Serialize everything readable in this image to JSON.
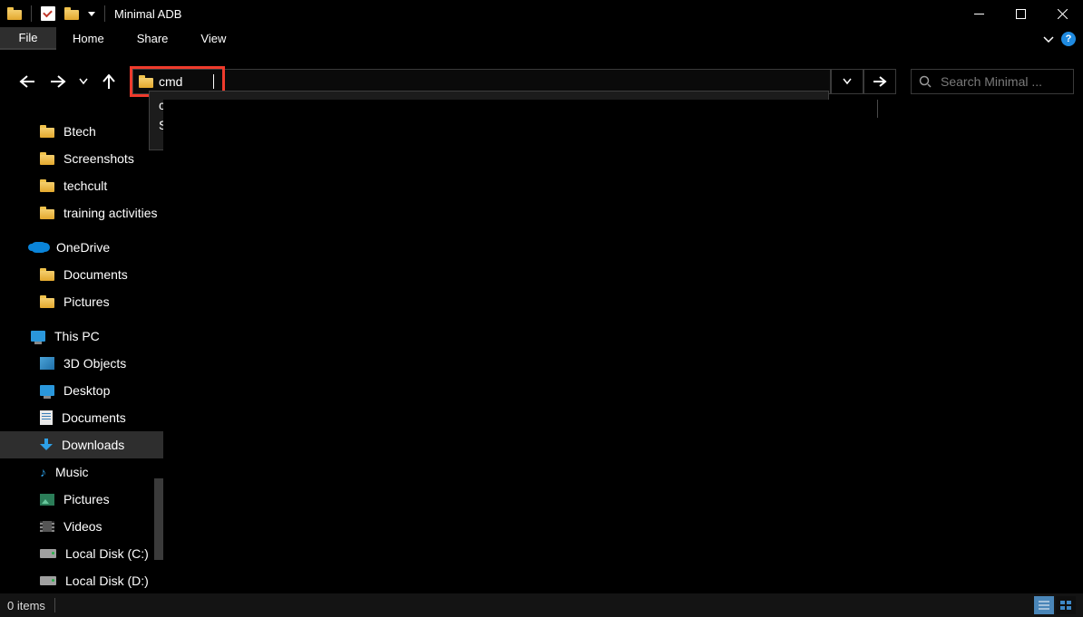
{
  "window": {
    "title": "Minimal ADB"
  },
  "ribbon": {
    "file": "File",
    "tabs": [
      "Home",
      "Share",
      "View"
    ]
  },
  "addressbar": {
    "value": "cmd",
    "dropdown": {
      "line1": "cmd",
      "line2": "Search for \"cmd\""
    }
  },
  "search": {
    "placeholder": "Search Minimal ..."
  },
  "sidebar": {
    "quick": [
      "Btech",
      "Screenshots",
      "techcult",
      "training activities"
    ],
    "onedrive": {
      "label": "OneDrive",
      "children": [
        "Documents",
        "Pictures"
      ]
    },
    "thispc": {
      "label": "This PC",
      "children": [
        "3D Objects",
        "Desktop",
        "Documents",
        "Downloads",
        "Music",
        "Pictures",
        "Videos",
        "Local Disk (C:)",
        "Local Disk (D:)"
      ]
    }
  },
  "selected_sidebar_item": "Downloads",
  "status": {
    "text": "0 items"
  }
}
